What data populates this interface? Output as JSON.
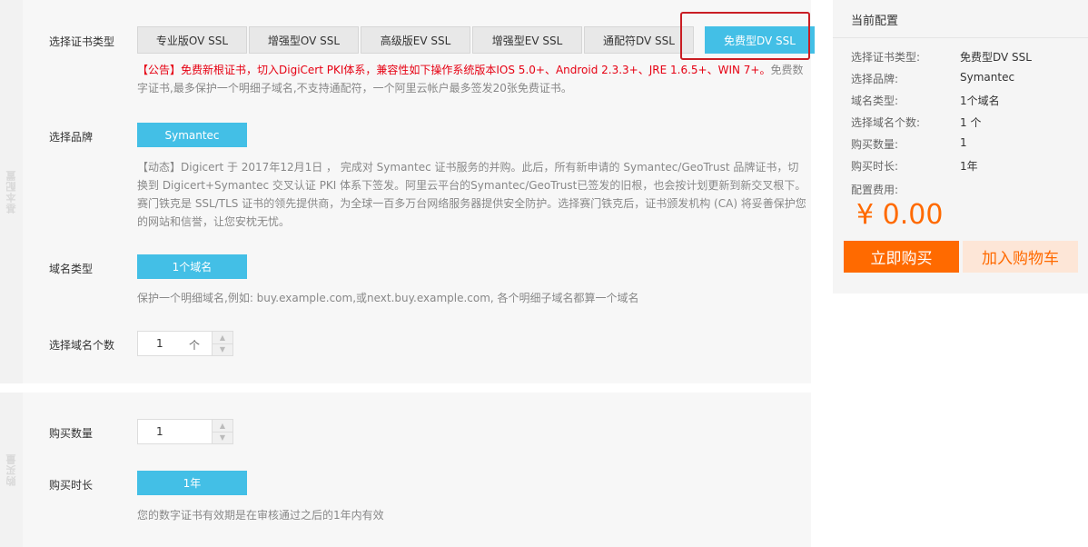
{
  "sidebar": {
    "section1": "基本配置",
    "section2": "购买量"
  },
  "cert_type": {
    "label": "选择证书类型",
    "tabs": [
      "专业版OV SSL",
      "增强型OV SSL",
      "高级版EV SSL",
      "增强型EV SSL",
      "通配符DV SSL",
      "免费型DV SSL"
    ],
    "selected": "免费型DV SSL",
    "notice_red": "【公告】免费新根证书，切入DigiCert PKI体系，兼容性如下操作系统版本IOS 5.0+、Android 2.3.3+、JRE 1.6.5+、WIN 7+。",
    "notice_gray": "免费数字证书,最多保护一个明细子域名,不支持通配符，一个阿里云帐户最多签发20张免费证书。"
  },
  "brand": {
    "label": "选择品牌",
    "selected": "Symantec",
    "desc": "【动态】Digicert 于 2017年12月1日 ， 完成对 Symantec 证书服务的并购。此后，所有新申请的 Symantec/GeoTrust 品牌证书，切换到 Digicert+Symantec 交叉认证 PKI 体系下签发。阿里云平台的Symantec/GeoTrust已签发的旧根，也会按计划更新到新交叉根下。",
    "desc2": "赛门铁克是 SSL/TLS 证书的领先提供商，为全球一百多万台网络服务器提供安全防护。选择赛门铁克后，证书颁发机构 (CA) 将妥善保护您的网站和信誉，让您安枕无忧。"
  },
  "domain_type": {
    "label": "域名类型",
    "selected": "1个域名",
    "desc": "保护一个明细域名,例如: buy.example.com,或next.buy.example.com, 各个明细子域名都算一个域名"
  },
  "domain_count": {
    "label": "选择域名个数",
    "value": "1",
    "unit": "个"
  },
  "purchase": {
    "qty_label": "购买数量",
    "qty_value": "1",
    "duration_label": "购买时长",
    "duration_selected": "1年",
    "duration_desc": "您的数字证书有效期是在审核通过之后的1年内有效"
  },
  "summary": {
    "title": "当前配置",
    "rows": [
      {
        "label": "选择证书类型:",
        "value": "免费型DV SSL"
      },
      {
        "label": "选择品牌:",
        "value": "Symantec"
      },
      {
        "label": "域名类型:",
        "value": "1个域名"
      },
      {
        "label": "选择域名个数:",
        "value": "1 个"
      },
      {
        "label": "购买数量:",
        "value": "1"
      },
      {
        "label": "购买时长:",
        "value": "1年"
      }
    ],
    "fee_label": "配置费用:",
    "price": "¥ 0.00",
    "buy_label": "立即购买",
    "cart_label": "加入购物车"
  },
  "colors": {
    "accent": "#43bfe6",
    "orange": "#ff6a00",
    "notice_red": "#e60012",
    "highlight": "#c91e24"
  }
}
